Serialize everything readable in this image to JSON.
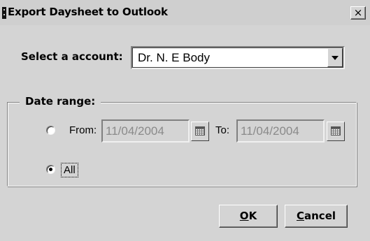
{
  "window": {
    "title": "Export Daysheet to Outlook",
    "close_glyph": "×"
  },
  "account": {
    "label": "Select a account:",
    "selected": "Dr. N. E Body"
  },
  "date_range": {
    "group_label": "Date range:",
    "from_label": "From:",
    "to_label": "To:",
    "from_value": "11/04/2004",
    "to_value": "11/04/2004",
    "all_label": "All",
    "selected_option": "All",
    "fields_enabled": false
  },
  "buttons": {
    "ok_mnemonic": "O",
    "ok_rest": "K",
    "cancel_mnemonic": "C",
    "cancel_rest": "ancel"
  },
  "icons": {
    "title_icon": "app-icon",
    "calendar": "calendar-icon",
    "dropdown": "chevron-down-icon"
  }
}
